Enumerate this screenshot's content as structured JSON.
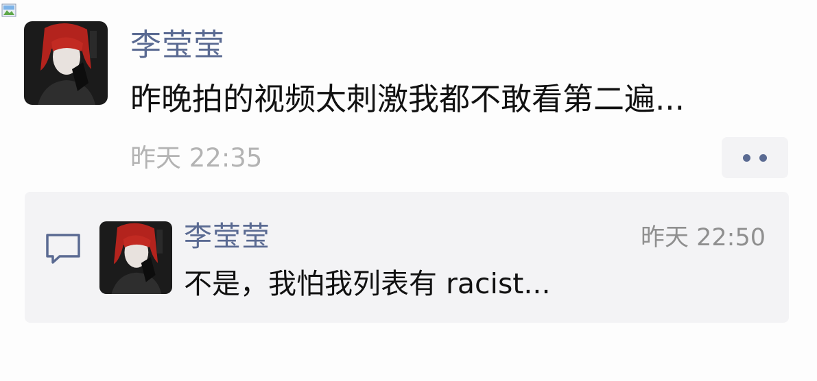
{
  "post": {
    "author": "李莹莹",
    "text": "昨晚拍的视频太刺激我都不敢看第二遍...",
    "time": "昨天 22:35"
  },
  "comments": [
    {
      "author": "李莹莹",
      "time": "昨天 22:50",
      "text": "不是，我怕我列表有 racist..."
    }
  ],
  "colors": {
    "name": "#5a6a92",
    "text": "#111111",
    "time": "#b3b3b3",
    "panel": "#f3f3f5"
  }
}
